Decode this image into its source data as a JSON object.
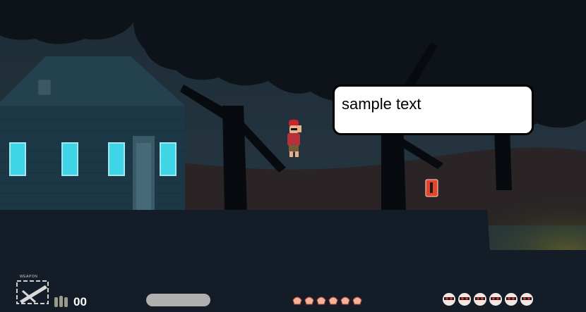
{
  "speech_bubble": {
    "text": "sample text"
  },
  "hud": {
    "weapon_label": "WEAPON",
    "ammo_count": "00",
    "bullet_icon": "bullet-icon",
    "crossbow_icon": "crossbow-icon",
    "collectible_icon": "gingerbread-icon",
    "enemy_icon": "skull-icon",
    "collectibles_count": 6,
    "enemies_count": 6
  },
  "colors": {
    "sky": "#16232e",
    "ground": "#141d27",
    "house": "#1e3a4a",
    "window_glow": "#3fd4e6",
    "speech_bg": "#ffffff",
    "health_bar": "#b0b0b0",
    "pickup": "#e2462a"
  }
}
